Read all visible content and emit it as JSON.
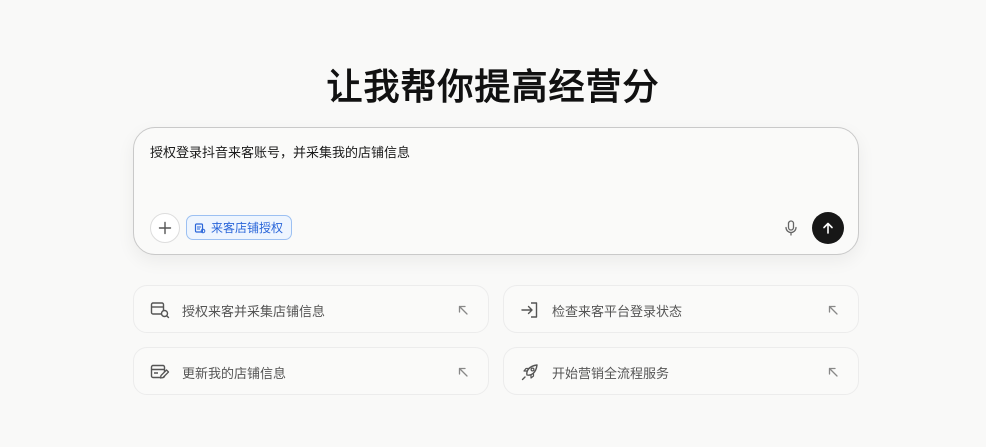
{
  "hero": {
    "title": "让我帮你提高经营分"
  },
  "composer": {
    "input_text": "授权登录抖音来客账号，并采集我的店铺信息",
    "add_icon": "plus-icon",
    "chip": {
      "label": "来客店铺授权",
      "icon": "store-icon",
      "color": "#2a66d9"
    },
    "mic_icon": "microphone-icon",
    "send_icon": "arrow-up-icon",
    "send_bg": "#171717"
  },
  "suggestions": [
    {
      "label": "授权来客并采集店铺信息",
      "icon": "store-search-icon"
    },
    {
      "label": "检查来客平台登录状态",
      "icon": "login-icon"
    },
    {
      "label": "更新我的店铺信息",
      "icon": "store-edit-icon"
    },
    {
      "label": "开始营销全流程服务",
      "icon": "rocket-icon"
    }
  ],
  "suggestion_arrow_icon": "arrow-up-left-icon"
}
